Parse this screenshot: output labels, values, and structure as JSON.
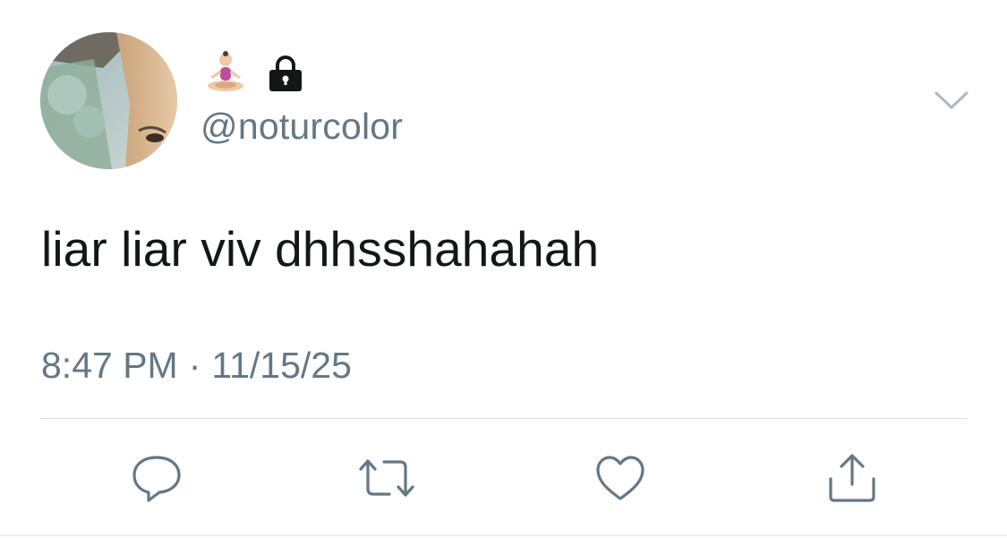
{
  "profile": {
    "display_name_icons": [
      "person-in-lotus-position-icon",
      "lock-icon"
    ],
    "handle": "@noturcolor"
  },
  "tweet": {
    "text": "liar liar viv dhhsshahahah",
    "time": "8:47 PM",
    "separator": "·",
    "date": "11/15/25"
  },
  "actions": {
    "icons": [
      "reply-icon",
      "retweet-icon",
      "like-icon",
      "share-icon"
    ]
  },
  "colors": {
    "text": "#14171a",
    "secondary": "#657786",
    "divider": "#d8dde2",
    "icon": "#657786"
  }
}
